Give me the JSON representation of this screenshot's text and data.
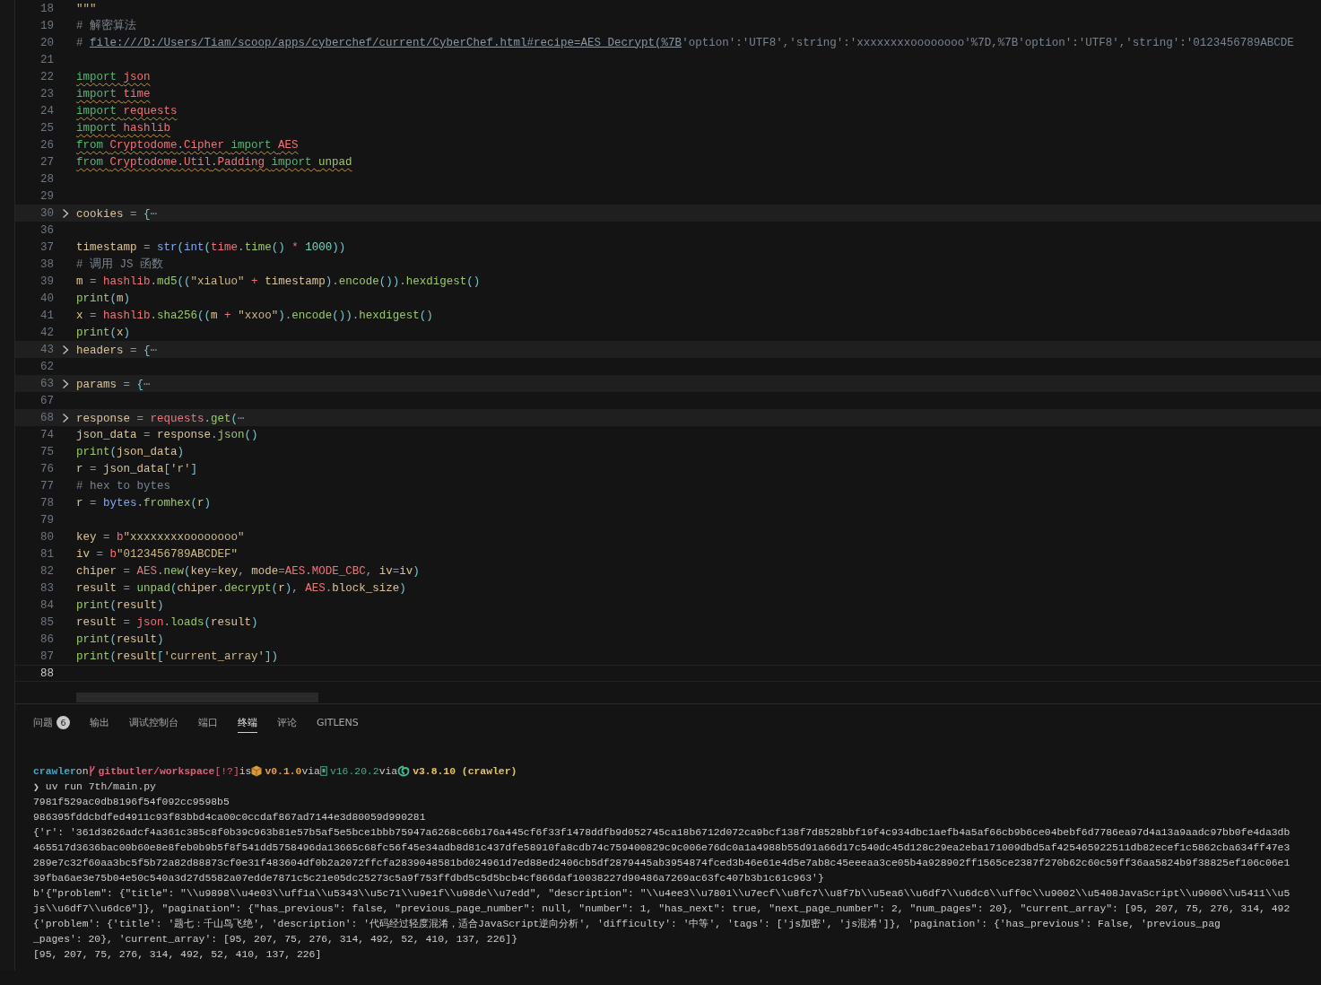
{
  "editor": {
    "lines": [
      {
        "number": "18",
        "current": false,
        "folded": false,
        "tokens": [
          {
            "text": "\"\"\"",
            "kind": "str"
          }
        ]
      },
      {
        "number": "19",
        "current": false,
        "folded": false,
        "squiggle": false,
        "tokens": [
          {
            "text": "# 解密算法",
            "kind": "com"
          }
        ]
      },
      {
        "number": "20",
        "current": false,
        "folded": false,
        "squiggle": false,
        "tokens": [
          {
            "text": "# ",
            "kind": "com"
          },
          {
            "text": "file:///D:/Users/Tiam/scoop/apps/cyberchef/current/CyberChef.html#recipe=AES_Decrypt(%7B",
            "kind": "link"
          },
          {
            "text": "'option':'UTF8','string':'xxxxxxxxoooooooo'%7D,%7B'option':'UTF8','string':'0123456789ABCDE",
            "kind": "com"
          }
        ]
      },
      {
        "number": "21",
        "current": false,
        "folded": false
      },
      {
        "number": "22",
        "current": false,
        "folded": false,
        "squiggle": true,
        "tokens": [
          {
            "text": "import ",
            "kind": "kw"
          },
          {
            "text": "json",
            "kind": "mod"
          }
        ]
      },
      {
        "number": "23",
        "current": false,
        "folded": false,
        "squiggle": true,
        "tokens": [
          {
            "text": "import ",
            "kind": "kw"
          },
          {
            "text": "time",
            "kind": "mod"
          }
        ]
      },
      {
        "number": "24",
        "current": false,
        "folded": false,
        "squiggle": true,
        "tokens": [
          {
            "text": "import ",
            "kind": "kw"
          },
          {
            "text": "requests",
            "kind": "mod"
          }
        ]
      },
      {
        "number": "25",
        "current": false,
        "folded": false,
        "squiggle": true,
        "tokens": [
          {
            "text": "import ",
            "kind": "kw"
          },
          {
            "text": "hashlib",
            "kind": "mod"
          }
        ]
      },
      {
        "number": "26",
        "current": false,
        "folded": false,
        "squiggle": true,
        "tokens": [
          {
            "text": "from ",
            "kind": "kw"
          },
          {
            "text": "Cryptodome",
            "kind": "mod"
          },
          {
            "text": ".",
            "kind": "pl"
          },
          {
            "text": "Cipher ",
            "kind": "mod"
          },
          {
            "text": "import ",
            "kind": "kw"
          },
          {
            "text": "AES",
            "kind": "mod"
          }
        ]
      },
      {
        "number": "27",
        "current": false,
        "folded": false,
        "squiggle": true,
        "tokens": [
          {
            "text": "from ",
            "kind": "kw"
          },
          {
            "text": "Cryptodome",
            "kind": "mod"
          },
          {
            "text": ".",
            "kind": "pl"
          },
          {
            "text": "Util",
            "kind": "mod"
          },
          {
            "text": ".",
            "kind": "pl"
          },
          {
            "text": "Padding ",
            "kind": "mod"
          },
          {
            "text": "import ",
            "kind": "kw"
          },
          {
            "text": "unpad",
            "kind": "fn"
          }
        ]
      },
      {
        "number": "28",
        "current": false,
        "folded": false
      },
      {
        "number": "29",
        "current": false,
        "folded": false
      },
      {
        "number": "30",
        "current": false,
        "folded": true,
        "squiggle": false,
        "tokens": [
          {
            "text": "cookies",
            "kind": "var"
          },
          {
            "text": " = ",
            "kind": "op"
          },
          {
            "text": "{",
            "kind": "pun"
          },
          {
            "text": "⋯",
            "kind": "com"
          }
        ]
      },
      {
        "number": "36",
        "current": false,
        "folded": false
      },
      {
        "number": "37",
        "current": false,
        "folded": false,
        "squiggle": false,
        "tokens": [
          {
            "text": "timestamp",
            "kind": "var"
          },
          {
            "text": " = ",
            "kind": "op"
          },
          {
            "text": "str",
            "kind": "bi"
          },
          {
            "text": "(",
            "kind": "pun"
          },
          {
            "text": "int",
            "kind": "bi"
          },
          {
            "text": "(",
            "kind": "pun"
          },
          {
            "text": "time",
            "kind": "mod"
          },
          {
            "text": ".",
            "kind": "pl"
          },
          {
            "text": "time",
            "kind": "fn"
          },
          {
            "text": "() ",
            "kind": "pun"
          },
          {
            "text": "* ",
            "kind": "opx"
          },
          {
            "text": "1000",
            "kind": "num"
          },
          {
            "text": "))",
            "kind": "pun"
          }
        ]
      },
      {
        "number": "38",
        "current": false,
        "folded": false,
        "squiggle": false,
        "tokens": [
          {
            "text": "# 调用 JS 函数",
            "kind": "com"
          }
        ]
      },
      {
        "number": "39",
        "current": false,
        "folded": false,
        "squiggle": false,
        "tokens": [
          {
            "text": "m",
            "kind": "var"
          },
          {
            "text": " = ",
            "kind": "op"
          },
          {
            "text": "hashlib",
            "kind": "mod"
          },
          {
            "text": ".",
            "kind": "pl"
          },
          {
            "text": "md5",
            "kind": "fn"
          },
          {
            "text": "((",
            "kind": "pun"
          },
          {
            "text": "\"xialuo\" ",
            "kind": "str"
          },
          {
            "text": "+ ",
            "kind": "opx"
          },
          {
            "text": "timestamp",
            "kind": "var"
          },
          {
            "text": ")",
            "kind": "pun"
          },
          {
            "text": ".",
            "kind": "pl"
          },
          {
            "text": "encode",
            "kind": "fn"
          },
          {
            "text": "())",
            "kind": "pun"
          },
          {
            "text": ".",
            "kind": "pl"
          },
          {
            "text": "hexdigest",
            "kind": "fn"
          },
          {
            "text": "()",
            "kind": "pun"
          }
        ]
      },
      {
        "number": "40",
        "current": false,
        "folded": false,
        "squiggle": false,
        "tokens": [
          {
            "text": "print",
            "kind": "fn"
          },
          {
            "text": "(",
            "kind": "pun"
          },
          {
            "text": "m",
            "kind": "var"
          },
          {
            "text": ")",
            "kind": "pun"
          }
        ]
      },
      {
        "number": "41",
        "current": false,
        "folded": false,
        "squiggle": false,
        "tokens": [
          {
            "text": "x",
            "kind": "var"
          },
          {
            "text": " = ",
            "kind": "op"
          },
          {
            "text": "hashlib",
            "kind": "mod"
          },
          {
            "text": ".",
            "kind": "pl"
          },
          {
            "text": "sha256",
            "kind": "fn"
          },
          {
            "text": "((",
            "kind": "pun"
          },
          {
            "text": "m ",
            "kind": "var"
          },
          {
            "text": "+ ",
            "kind": "opx"
          },
          {
            "text": "\"xxoo\"",
            "kind": "str"
          },
          {
            "text": ")",
            "kind": "pun"
          },
          {
            "text": ".",
            "kind": "pl"
          },
          {
            "text": "encode",
            "kind": "fn"
          },
          {
            "text": "())",
            "kind": "pun"
          },
          {
            "text": ".",
            "kind": "pl"
          },
          {
            "text": "hexdigest",
            "kind": "fn"
          },
          {
            "text": "()",
            "kind": "pun"
          }
        ]
      },
      {
        "number": "42",
        "current": false,
        "folded": false,
        "squiggle": false,
        "tokens": [
          {
            "text": "print",
            "kind": "fn"
          },
          {
            "text": "(",
            "kind": "pun"
          },
          {
            "text": "x",
            "kind": "var"
          },
          {
            "text": ")",
            "kind": "pun"
          }
        ]
      },
      {
        "number": "43",
        "current": false,
        "folded": true,
        "squiggle": false,
        "tokens": [
          {
            "text": "headers",
            "kind": "var"
          },
          {
            "text": " = ",
            "kind": "op"
          },
          {
            "text": "{",
            "kind": "pun"
          },
          {
            "text": "⋯",
            "kind": "com"
          }
        ]
      },
      {
        "number": "62",
        "current": false,
        "folded": false
      },
      {
        "number": "63",
        "current": false,
        "folded": true,
        "squiggle": false,
        "tokens": [
          {
            "text": "params",
            "kind": "var"
          },
          {
            "text": " = ",
            "kind": "op"
          },
          {
            "text": "{",
            "kind": "pun"
          },
          {
            "text": "⋯",
            "kind": "com"
          }
        ]
      },
      {
        "number": "67",
        "current": false,
        "folded": false
      },
      {
        "number": "68",
        "current": false,
        "folded": true,
        "squiggle": false,
        "tokens": [
          {
            "text": "response",
            "kind": "var"
          },
          {
            "text": " = ",
            "kind": "op"
          },
          {
            "text": "requests",
            "kind": "mod"
          },
          {
            "text": ".",
            "kind": "pl"
          },
          {
            "text": "get",
            "kind": "fn"
          },
          {
            "text": "(",
            "kind": "pun"
          },
          {
            "text": "⋯",
            "kind": "com"
          }
        ]
      },
      {
        "number": "74",
        "current": false,
        "folded": false,
        "squiggle": false,
        "tokens": [
          {
            "text": "json_data",
            "kind": "var"
          },
          {
            "text": " = ",
            "kind": "op"
          },
          {
            "text": "response",
            "kind": "var"
          },
          {
            "text": ".",
            "kind": "pl"
          },
          {
            "text": "json",
            "kind": "fn"
          },
          {
            "text": "()",
            "kind": "pun"
          }
        ]
      },
      {
        "number": "75",
        "current": false,
        "folded": false,
        "squiggle": false,
        "tokens": [
          {
            "text": "print",
            "kind": "fn"
          },
          {
            "text": "(",
            "kind": "pun"
          },
          {
            "text": "json_data",
            "kind": "var"
          },
          {
            "text": ")",
            "kind": "pun"
          }
        ]
      },
      {
        "number": "76",
        "current": false,
        "folded": false,
        "squiggle": false,
        "tokens": [
          {
            "text": "r",
            "kind": "var"
          },
          {
            "text": " = ",
            "kind": "op"
          },
          {
            "text": "json_data",
            "kind": "var"
          },
          {
            "text": "[",
            "kind": "pun"
          },
          {
            "text": "'r'",
            "kind": "str"
          },
          {
            "text": "]",
            "kind": "pun"
          }
        ]
      },
      {
        "number": "77",
        "current": false,
        "folded": false,
        "squiggle": false,
        "tokens": [
          {
            "text": "# hex to bytes",
            "kind": "com"
          }
        ]
      },
      {
        "number": "78",
        "current": false,
        "folded": false,
        "squiggle": false,
        "tokens": [
          {
            "text": "r",
            "kind": "var"
          },
          {
            "text": " = ",
            "kind": "op"
          },
          {
            "text": "bytes",
            "kind": "bi"
          },
          {
            "text": ".",
            "kind": "pl"
          },
          {
            "text": "fromhex",
            "kind": "fn"
          },
          {
            "text": "(",
            "kind": "pun"
          },
          {
            "text": "r",
            "kind": "var"
          },
          {
            "text": ")",
            "kind": "pun"
          }
        ]
      },
      {
        "number": "79",
        "current": false,
        "folded": false
      },
      {
        "number": "80",
        "current": false,
        "folded": false,
        "squiggle": false,
        "tokens": [
          {
            "text": "key",
            "kind": "var"
          },
          {
            "text": " = ",
            "kind": "op"
          },
          {
            "text": "b",
            "kind": "mod"
          },
          {
            "text": "\"xxxxxxxxoooooooo\"",
            "kind": "str"
          }
        ]
      },
      {
        "number": "81",
        "current": false,
        "folded": false,
        "squiggle": false,
        "tokens": [
          {
            "text": "iv",
            "kind": "var"
          },
          {
            "text": " = ",
            "kind": "op"
          },
          {
            "text": "b",
            "kind": "mod"
          },
          {
            "text": "\"0123456789ABCDEF\"",
            "kind": "str"
          }
        ]
      },
      {
        "number": "82",
        "current": false,
        "folded": false,
        "squiggle": false,
        "tokens": [
          {
            "text": "chiper",
            "kind": "var"
          },
          {
            "text": " = ",
            "kind": "op"
          },
          {
            "text": "AES",
            "kind": "mod"
          },
          {
            "text": ".",
            "kind": "pl"
          },
          {
            "text": "new",
            "kind": "fn"
          },
          {
            "text": "(",
            "kind": "pun"
          },
          {
            "text": "key",
            "kind": "var"
          },
          {
            "text": "=",
            "kind": "op"
          },
          {
            "text": "key",
            "kind": "var"
          },
          {
            "text": ", ",
            "kind": "pl"
          },
          {
            "text": "mode",
            "kind": "var"
          },
          {
            "text": "=",
            "kind": "op"
          },
          {
            "text": "AES",
            "kind": "mod"
          },
          {
            "text": ".",
            "kind": "pl"
          },
          {
            "text": "MODE_CBC",
            "kind": "mod"
          },
          {
            "text": ", ",
            "kind": "pl"
          },
          {
            "text": "iv",
            "kind": "var"
          },
          {
            "text": "=",
            "kind": "op"
          },
          {
            "text": "iv",
            "kind": "var"
          },
          {
            "text": ")",
            "kind": "pun"
          }
        ]
      },
      {
        "number": "83",
        "current": false,
        "folded": false,
        "squiggle": false,
        "tokens": [
          {
            "text": "result",
            "kind": "var"
          },
          {
            "text": " = ",
            "kind": "op"
          },
          {
            "text": "unpad",
            "kind": "fn"
          },
          {
            "text": "(",
            "kind": "pun"
          },
          {
            "text": "chiper",
            "kind": "var"
          },
          {
            "text": ".",
            "kind": "pl"
          },
          {
            "text": "decrypt",
            "kind": "fn"
          },
          {
            "text": "(",
            "kind": "pun"
          },
          {
            "text": "r",
            "kind": "var"
          },
          {
            "text": ")",
            "kind": "pun"
          },
          {
            "text": ", ",
            "kind": "pl"
          },
          {
            "text": "AES",
            "kind": "mod"
          },
          {
            "text": ".",
            "kind": "pl"
          },
          {
            "text": "block_size",
            "kind": "var"
          },
          {
            "text": ")",
            "kind": "pun"
          }
        ]
      },
      {
        "number": "84",
        "current": false,
        "folded": false,
        "squiggle": false,
        "tokens": [
          {
            "text": "print",
            "kind": "fn"
          },
          {
            "text": "(",
            "kind": "pun"
          },
          {
            "text": "result",
            "kind": "var"
          },
          {
            "text": ")",
            "kind": "pun"
          }
        ]
      },
      {
        "number": "85",
        "current": false,
        "folded": false,
        "squiggle": false,
        "tokens": [
          {
            "text": "result",
            "kind": "var"
          },
          {
            "text": " = ",
            "kind": "op"
          },
          {
            "text": "json",
            "kind": "mod"
          },
          {
            "text": ".",
            "kind": "pl"
          },
          {
            "text": "loads",
            "kind": "fn"
          },
          {
            "text": "(",
            "kind": "pun"
          },
          {
            "text": "result",
            "kind": "var"
          },
          {
            "text": ")",
            "kind": "pun"
          }
        ]
      },
      {
        "number": "86",
        "current": false,
        "folded": false,
        "squiggle": false,
        "tokens": [
          {
            "text": "print",
            "kind": "fn"
          },
          {
            "text": "(",
            "kind": "pun"
          },
          {
            "text": "result",
            "kind": "var"
          },
          {
            "text": ")",
            "kind": "pun"
          }
        ]
      },
      {
        "number": "87",
        "current": false,
        "folded": false,
        "squiggle": false,
        "tokens": [
          {
            "text": "print",
            "kind": "fn"
          },
          {
            "text": "(",
            "kind": "pun"
          },
          {
            "text": "result",
            "kind": "var"
          },
          {
            "text": "[",
            "kind": "pun"
          },
          {
            "text": "'current_array'",
            "kind": "str"
          },
          {
            "text": "])",
            "kind": "pun"
          }
        ]
      },
      {
        "number": "88",
        "current": true,
        "folded": false
      }
    ]
  },
  "panel": {
    "tabs": [
      {
        "label": "问题",
        "badge": "6",
        "selected": false
      },
      {
        "label": "输出",
        "selected": false
      },
      {
        "label": "调试控制台",
        "selected": false
      },
      {
        "label": "端口",
        "selected": false
      },
      {
        "label": "终端",
        "selected": true
      },
      {
        "label": "评论",
        "selected": false
      },
      {
        "label": "GITLENS",
        "selected": false
      }
    ]
  },
  "terminal": {
    "prompt": [
      {
        "text": "crawler",
        "kind": "dir"
      },
      {
        "text": "on",
        "kind": "word"
      },
      {
        "text": "gitbutler/workspace",
        "kind": "branch"
      },
      {
        "text": "[!?]",
        "kind": "status"
      },
      {
        "text": "is",
        "kind": "word"
      },
      {
        "text": "v0.1.0",
        "kind": "package"
      },
      {
        "text": "via",
        "kind": "word"
      },
      {
        "text": "v16.20.2",
        "kind": "node"
      },
      {
        "text": "via",
        "kind": "word"
      },
      {
        "text": "v3.8.10 (crawler)",
        "kind": "python"
      }
    ],
    "command": {
      "symbol": "❯",
      "text": "uv run 7th/main.py"
    },
    "output": [
      "7981f529ac0db8196f54f092cc9598b5",
      "986395fddcbdfed4911c93f83bbd4ca00c0ccdaf867ad7144e3d80059d990281",
      "{'r': '361d3626adcf4a361c385c8f0b39c963b81e57b5af5e5bce1bbb75947a6268c66b176a445cf6f33f1478ddfb9d052745ca18b6712d072ca9bcf138f7d8528bbf19f4c934dbc1aefb4a5af66cb9b6ce04bebf6d7786ea97d4a13a9aadc97bb0fe4da3db",
      "465517d3636bac00b60e8e8feb0b9b5f8f541dd5758496da13665c68fc56f45e34adb8d81c437dfe58910fa8cdb74c759400829c9c006e76dc0a1a4988b55d91a66d17c540dc45d128c29ea2eba171009dbd5af425465922511db82ecef1c5862cba634ff47e3",
      "289e7c32f60aa3bc5f5b72a82d88873cf0e31f483604df0b2a2072ffcfa2839048581bd024961d7ed88ed2406cb5df2879445ab3954874fced3b46e61e4d5e7ab8c45eeeaa3ce05b4a928902ff1565ce2387f270b62c60c59ff36aa5824b9f38825ef106c06e1",
      "39fba6ae3e75b04e50c540a3d27d5582a07edde7871c5c21e05dc25273c5a9f753ffdbd5c5d5bcb4cf866daf10038227d90486a7269ac63fc407b3b1c61c963'}",
      "b'{\"problem\": {\"title\": \"\\\\u9898\\\\u4e03\\\\uff1a\\\\u5343\\\\u5c71\\\\u9e1f\\\\u98de\\\\u7edd\", \"description\": \"\\\\u4ee3\\\\u7801\\\\u7ecf\\\\u8fc7\\\\u8f7b\\\\u5ea6\\\\u6df7\\\\u6dc6\\\\uff0c\\\\u9002\\\\u5408JavaScript\\\\u9006\\\\u5411\\\\u5",
      "js\\\\u6df7\\\\u6dc6\"]}, \"pagination\": {\"has_previous\": false, \"previous_page_number\": null, \"number\": 1, \"has_next\": true, \"next_page_number\": 2, \"num_pages\": 20}, \"current_array\": [95, 207, 75, 276, 314, 492",
      "{'problem': {'title': '题七：千山鸟飞绝', 'description': '代码经过轻度混淆，适合JavaScript逆向分析', 'difficulty': '中等', 'tags': ['js加密', 'js混淆']}, 'pagination': {'has_previous': False, 'previous_pag",
      "_pages': 20}, 'current_array': [95, 207, 75, 276, 314, 492, 52, 410, 137, 226]}",
      "[95, 207, 75, 276, 314, 492, 52, 410, 137, 226]"
    ]
  }
}
